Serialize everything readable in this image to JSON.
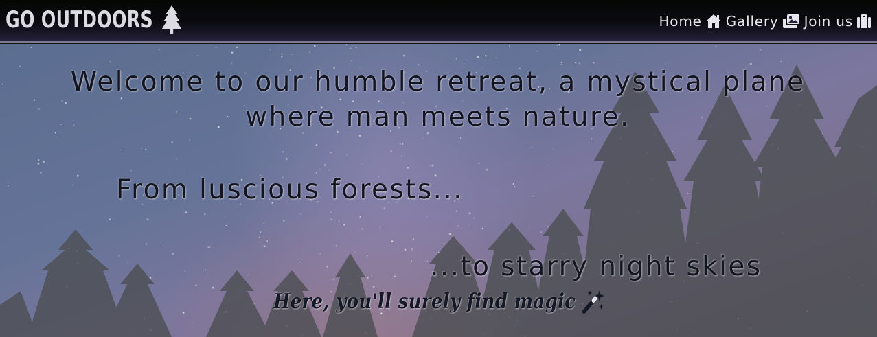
{
  "brand": {
    "name": "GO OUTDOORS",
    "icon": "tree-icon"
  },
  "nav": {
    "items": [
      {
        "label": "Home",
        "icon": "home-icon"
      },
      {
        "label": "Gallery",
        "icon": "gallery-icon"
      },
      {
        "label": "Join us",
        "icon": "briefcase-icon"
      }
    ]
  },
  "hero": {
    "welcome": "Welcome to our humble retreat, a mystical plane where man meets nature.",
    "forests": "From luscious forests...",
    "skies": "...to starry night skies",
    "magic": "Here, you'll surely find magic",
    "magic_icon": "magic-wand-icon"
  }
}
